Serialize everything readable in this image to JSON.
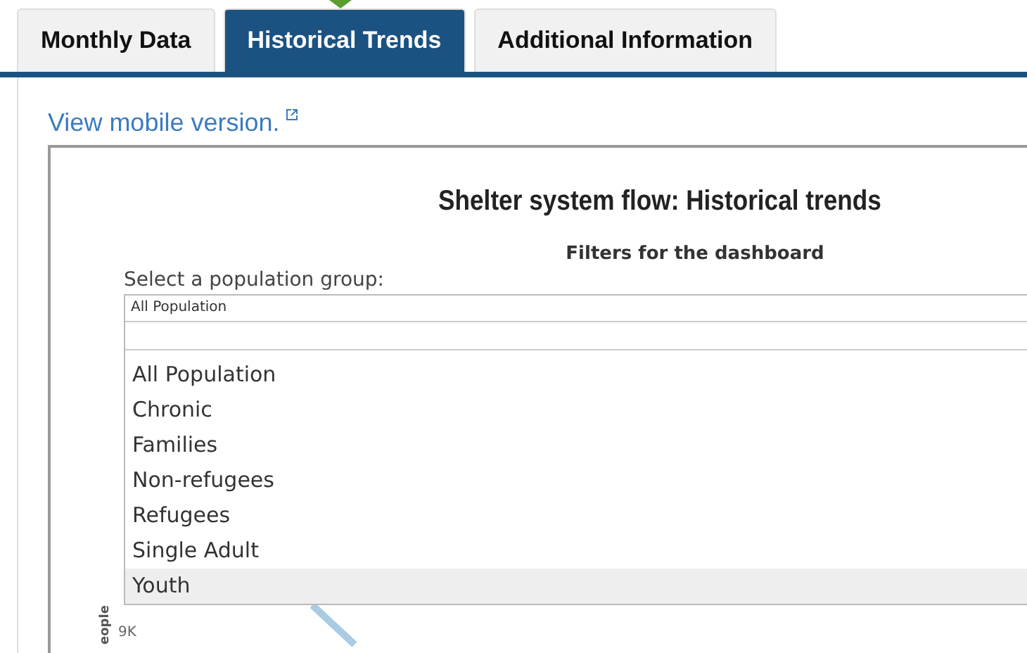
{
  "tabs": [
    {
      "label": "Monthly Data",
      "selected": false
    },
    {
      "label": "Historical Trends",
      "selected": true
    },
    {
      "label": "Additional Information",
      "selected": false
    }
  ],
  "link": {
    "label": "View mobile version."
  },
  "dashboard": {
    "title": "Shelter system flow: Historical trends",
    "subtitle": "Filters for the dashboard",
    "filter_label": "Select a population group:",
    "dropdown": {
      "value": "All Population",
      "options": [
        {
          "label": "All Population",
          "highlighted": false
        },
        {
          "label": "Chronic",
          "highlighted": false
        },
        {
          "label": "Families",
          "highlighted": false
        },
        {
          "label": "Non-refugees",
          "highlighted": false
        },
        {
          "label": "Refugees",
          "highlighted": false
        },
        {
          "label": "Single Adult",
          "highlighted": false
        },
        {
          "label": "Youth",
          "highlighted": true
        }
      ]
    },
    "chart": {
      "ylabel": "eople",
      "tick": "9K"
    }
  }
}
